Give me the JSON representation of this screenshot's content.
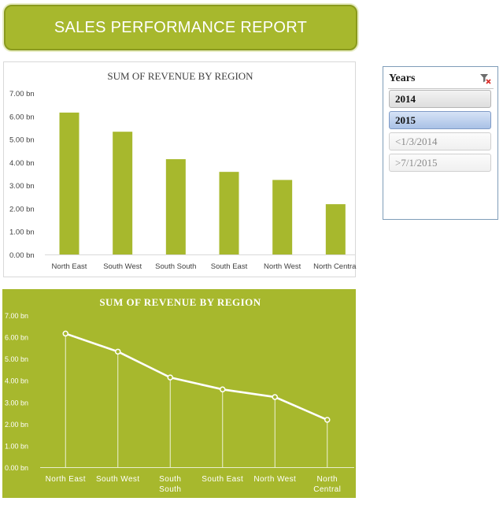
{
  "report": {
    "title": "SALES PERFORMANCE REPORT"
  },
  "slicer": {
    "title": "Years",
    "clear_filter_icon": "clear-filter-icon",
    "items": [
      {
        "label": "2014",
        "state": "selected"
      },
      {
        "label": "2015",
        "state": "selected-highlight"
      },
      {
        "label": "<1/3/2014",
        "state": "no-data"
      },
      {
        "label": ">7/1/2015",
        "state": "no-data"
      }
    ]
  },
  "colors": {
    "accent": "#a7b82d",
    "bar": "#a7b82d",
    "line": "#ffffff"
  },
  "chart_data": [
    {
      "type": "bar",
      "title": "SUM OF REVENUE BY REGION",
      "categories": [
        "North East",
        "South West",
        "South South",
        "South East",
        "North West",
        "North Central"
      ],
      "values": [
        6.15,
        5.32,
        4.13,
        3.58,
        3.23,
        2.18
      ],
      "ylim": [
        0,
        7
      ],
      "yticks": [
        "0.00 bn",
        "1.00 bn",
        "2.00 bn",
        "3.00 bn",
        "4.00 bn",
        "5.00 bn",
        "6.00 bn",
        "7.00 bn"
      ],
      "grid": false,
      "legend": "none"
    },
    {
      "type": "line",
      "title": "SUM OF REVENUE BY REGION",
      "categories": [
        "North East",
        "South West",
        "South South",
        "South East",
        "North West",
        "North Central"
      ],
      "category_lines": [
        [
          "North East"
        ],
        [
          "South West"
        ],
        [
          "South",
          "South"
        ],
        [
          "South East"
        ],
        [
          "North West"
        ],
        [
          "North",
          "Central"
        ]
      ],
      "values": [
        6.15,
        5.32,
        4.13,
        3.58,
        3.23,
        2.18
      ],
      "ylim": [
        0,
        7
      ],
      "yticks": [
        "0.00 bn",
        "1.00 bn",
        "2.00 bn",
        "3.00 bn",
        "4.00 bn",
        "5.00 bn",
        "6.00 bn",
        "7.00 bn"
      ],
      "grid": false,
      "drop_lines": true,
      "legend": "none"
    }
  ]
}
